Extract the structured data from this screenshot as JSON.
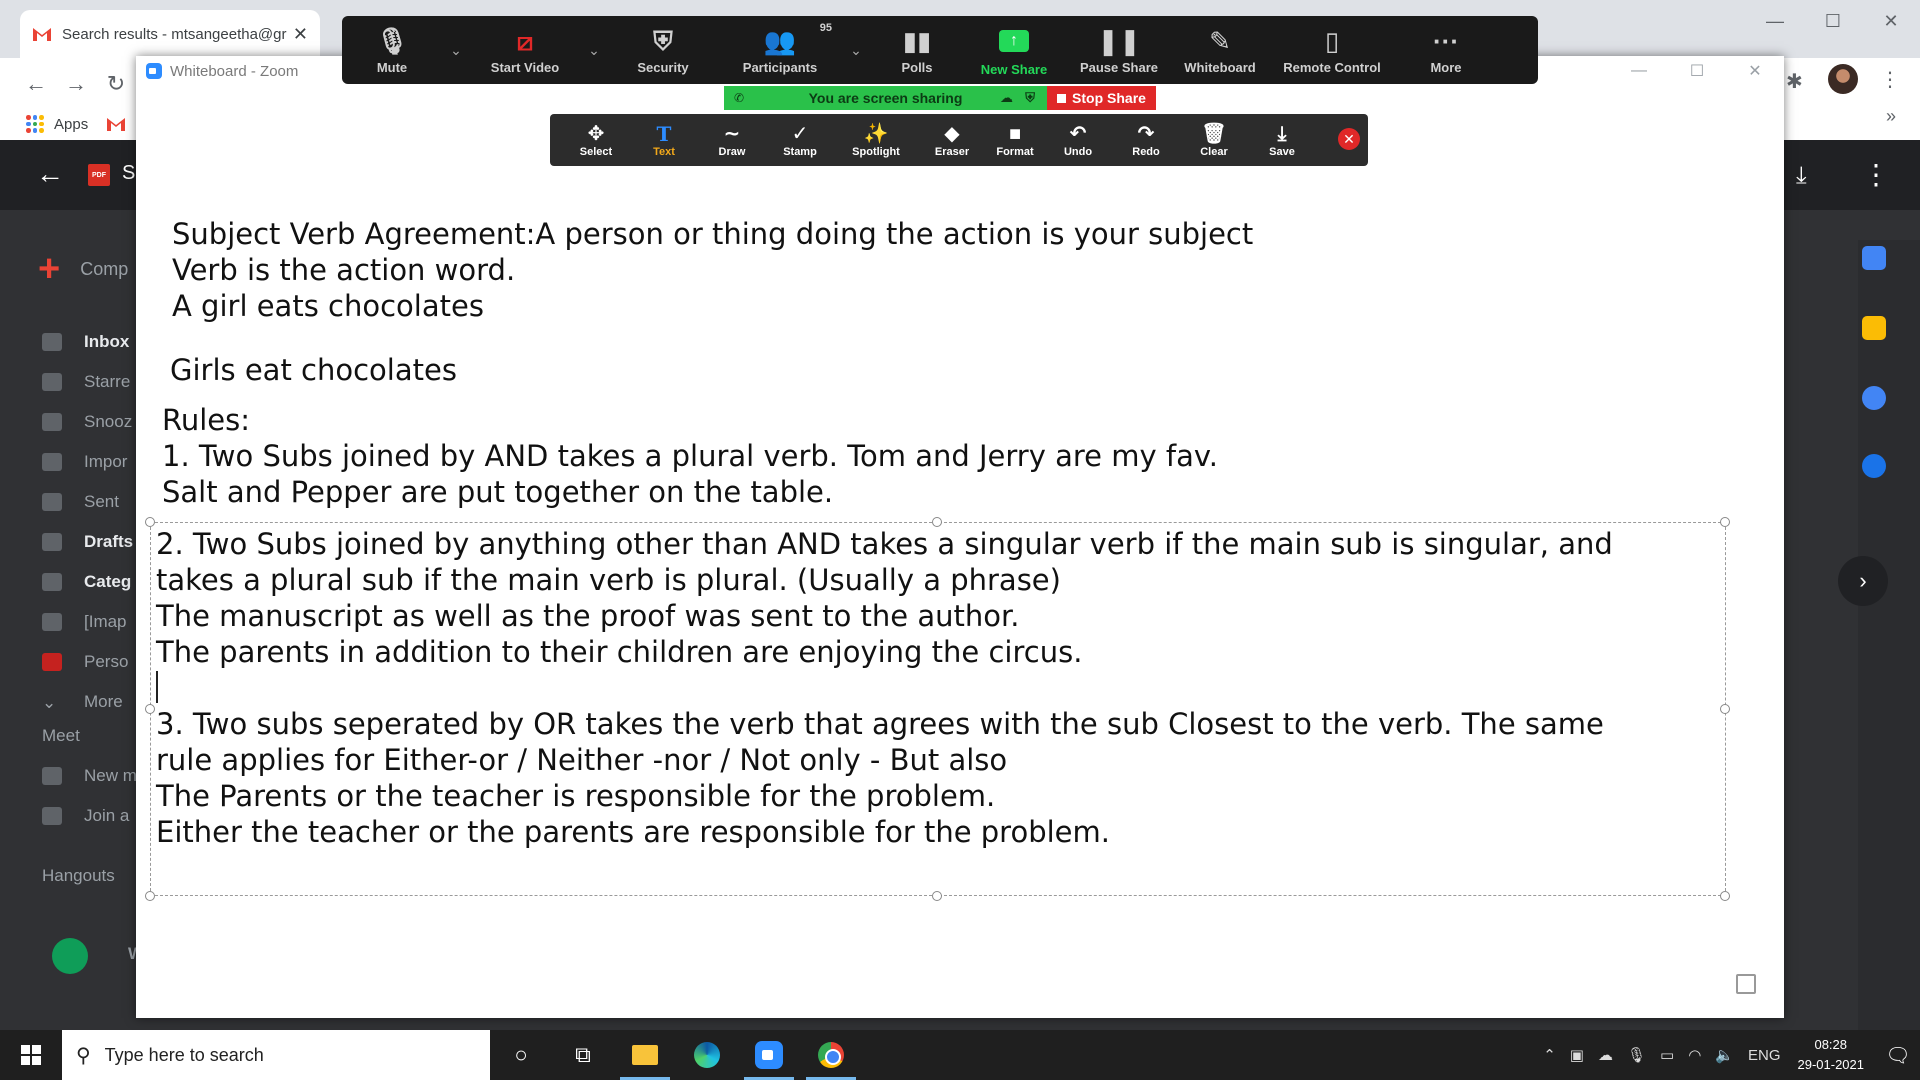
{
  "browser": {
    "tab_title": "Search results - mtsangeetha@gr",
    "bookmarks_label": "Apps"
  },
  "gmail": {
    "compose_label": "Comp",
    "header_fragment": "S",
    "sidebar": [
      "Inbox",
      "Starre",
      "Snooz",
      "Impor",
      "Sent",
      "Drafts",
      "Categ",
      "[Imap",
      "Perso",
      "More"
    ],
    "meet_label": "Meet",
    "meet_items": [
      "New m",
      "Join a"
    ],
    "hangouts_label": "Hangouts",
    "hangouts_item": "Welc"
  },
  "zoom": {
    "window_title": "Whiteboard - Zoom",
    "meeting_bar": {
      "mute": "Mute",
      "start_video": "Start Video",
      "security": "Security",
      "participants": "Participants",
      "participants_count": "95",
      "polls": "Polls",
      "new_share": "New Share",
      "pause_share": "Pause Share",
      "whiteboard": "Whiteboard",
      "remote_control": "Remote Control",
      "more": "More"
    },
    "sharing_status": "You are screen sharing",
    "stop_share": "Stop Share",
    "whiteboard_tools": [
      "Select",
      "Text",
      "Draw",
      "Stamp",
      "Spotlight",
      "Eraser",
      "Format",
      "Undo",
      "Redo",
      "Clear",
      "Save"
    ],
    "active_tool": "Text"
  },
  "whiteboard_content": {
    "line1": "Subject Verb Agreement:A person or thing doing the action is your subject",
    "line2": "Verb is the action word.",
    "line3": "A girl eats chocolates",
    "line4": "Girls eat chocolates",
    "rules_heading": "Rules:",
    "rule1": "1. Two Subs joined by AND takes a plural verb. Tom and Jerry are my fav.",
    "rule1_example": "Salt and Pepper are put together on the table.",
    "rule2_a": "2. Two Subs joined by anything other than AND takes a singular verb if the main sub is singular, and",
    "rule2_b": "takes a plural sub if the main verb is plural. (Usually a phrase)",
    "rule2_example1": "The manuscript as well as the proof was sent to the author.",
    "rule2_example2": "The parents in addition to their children are enjoying the circus.",
    "rule3_a": "3. Two subs seperated by OR takes the verb that agrees with the sub Closest to the verb. The same",
    "rule3_b": "rule applies for Either-or / Neither -nor / Not only - But also",
    "rule3_example1": "The Parents or the teacher is responsible for the problem.",
    "rule3_example2": "Either the teacher or the parents are responsible for the problem."
  },
  "taskbar": {
    "search_placeholder": "Type here to search",
    "language": "ENG",
    "time": "08:28",
    "date": "29-01-2021"
  }
}
